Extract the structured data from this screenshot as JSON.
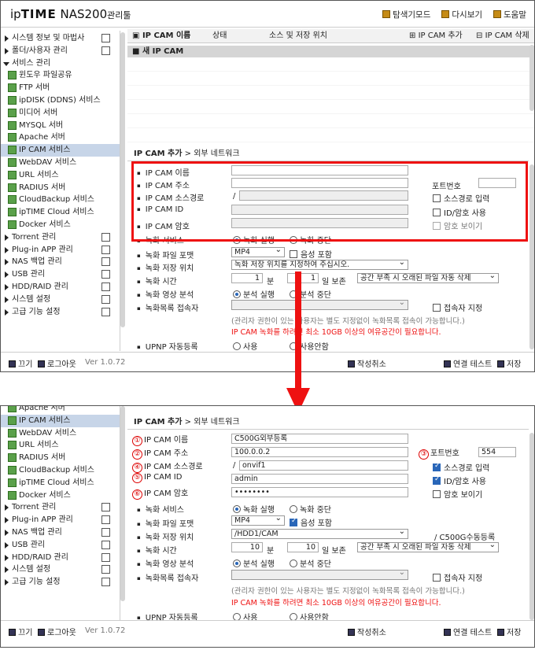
{
  "app": {
    "logo_ip": "ip",
    "logo_time": "TIME",
    "logo_model": "NAS200",
    "logo_suffix": "관리툴"
  },
  "toplinks": [
    "탐색기모드",
    "다시보기",
    "도움말"
  ],
  "sidebar": {
    "shot1": [
      {
        "label": "시스템 정보 및 마법사",
        "kind": "top"
      },
      {
        "label": "폴더/사용자 관리",
        "kind": "top"
      },
      {
        "label": "서비스 관리",
        "kind": "open"
      },
      {
        "label": "윈도우 파일공유",
        "kind": "sub"
      },
      {
        "label": "FTP 서버",
        "kind": "sub"
      },
      {
        "label": "ipDISK (DDNS) 서비스",
        "kind": "sub"
      },
      {
        "label": "미디어 서버",
        "kind": "sub"
      },
      {
        "label": "MYSQL 서버",
        "kind": "sub"
      },
      {
        "label": "Apache 서버",
        "kind": "sub"
      },
      {
        "label": "IP CAM 서비스",
        "kind": "sub",
        "selected": true
      },
      {
        "label": "WebDAV 서비스",
        "kind": "sub"
      },
      {
        "label": "URL 서비스",
        "kind": "sub"
      },
      {
        "label": "RADIUS 서버",
        "kind": "sub"
      },
      {
        "label": "CloudBackup 서비스",
        "kind": "sub"
      },
      {
        "label": "ipTIME Cloud 서비스",
        "kind": "sub"
      },
      {
        "label": "Docker 서비스",
        "kind": "sub"
      },
      {
        "label": "Torrent 관리",
        "kind": "top"
      },
      {
        "label": "Plug-in APP 관리",
        "kind": "top"
      },
      {
        "label": "NAS 백업 관리",
        "kind": "top"
      },
      {
        "label": "USB 관리",
        "kind": "top"
      },
      {
        "label": "HDD/RAID 관리",
        "kind": "top"
      },
      {
        "label": "시스템 설정",
        "kind": "top"
      },
      {
        "label": "고급 기능 설정",
        "kind": "top"
      }
    ],
    "shot2": [
      {
        "label": "Apache 서버",
        "kind": "sub"
      },
      {
        "label": "IP CAM 서비스",
        "kind": "sub",
        "selected": true
      },
      {
        "label": "WebDAV 서비스",
        "kind": "sub"
      },
      {
        "label": "URL 서비스",
        "kind": "sub"
      },
      {
        "label": "RADIUS 서버",
        "kind": "sub"
      },
      {
        "label": "CloudBackup 서비스",
        "kind": "sub"
      },
      {
        "label": "ipTIME Cloud 서비스",
        "kind": "sub"
      },
      {
        "label": "Docker 서비스",
        "kind": "sub"
      },
      {
        "label": "Torrent 관리",
        "kind": "top"
      },
      {
        "label": "Plug-in APP 관리",
        "kind": "top"
      },
      {
        "label": "NAS 백업 관리",
        "kind": "top"
      },
      {
        "label": "USB 관리",
        "kind": "top"
      },
      {
        "label": "HDD/RAID 관리",
        "kind": "top"
      },
      {
        "label": "시스템 설정",
        "kind": "top"
      },
      {
        "label": "고급 기능 설정",
        "kind": "top"
      }
    ]
  },
  "list": {
    "col_name": "IP CAM 이름",
    "col_status": "상태",
    "col_source": "소스 및 저장 위치",
    "add_btn": "IP CAM 추가",
    "del_btn": "IP CAM 삭제",
    "new_item": "새 IP CAM"
  },
  "section_title": "IP CAM 추가",
  "section_sub": " > 외부 네트워크",
  "labels": {
    "name": "IP CAM 이름",
    "addr": "IP CAM 주소",
    "src": "IP CAM 소스경로",
    "id": "IP CAM ID",
    "pw": "IP CAM 암호",
    "port": "포트번호",
    "rec_svc": "녹화 서비스",
    "rec_fmt": "녹화 파일 포맷",
    "rec_loc": "녹화 저장 위치",
    "rec_time": "녹화 시간",
    "analysis": "녹화 영상 분석",
    "access": "녹화목록 접속자",
    "upnp": "UPNP 자동등록"
  },
  "opts": {
    "src_input": "소스경로 입력",
    "id_pw_use": "ID/암호 사용",
    "show_pw": "암호 보이기",
    "rec_on": "녹화 실행",
    "rec_off": "녹화 중단",
    "audio": "음성 포함",
    "ana_on": "분석 실행",
    "ana_off": "분석 중단",
    "acc_chk": "접속자 지정",
    "upnp_use": "사용",
    "upnp_nouse": "사용안함",
    "minute": "분",
    "keep_day": "일 보존",
    "auto_del": "공간 부족 시 오래된 파일 자동 삭제",
    "slash": "/"
  },
  "notes": {
    "access": "(관리자 권한이 있는 사용자는 별도 지정없이 녹화목록 접속이 가능합니다.)",
    "space": "IP CAM 녹화를 하려면 최소 10GB 이상의 여유공간이 필요합니다."
  },
  "form1": {
    "fmt": "MP4",
    "loc": "녹화 저장 위치를 지정하여 주십시오.",
    "rec_min": "1",
    "keep": "1"
  },
  "form2": {
    "name": "C500G외부등록",
    "addr": "100.0.0.2",
    "port": "554",
    "src": "onvif1",
    "id": "admin",
    "pw": "••••••••",
    "fmt": "MP4",
    "loc": "/HDD1/CAM",
    "loc_suffix": "/ C500G수동등록",
    "rec_min": "10",
    "keep": "10"
  },
  "markers": [
    "①",
    "②",
    "③",
    "④",
    "⑤",
    "⑥"
  ],
  "footer": {
    "off": "끄기",
    "logout": "로그아웃",
    "version": "Ver 1.0.72",
    "cancel": "작성취소",
    "test": "연결 테스트",
    "save": "저장"
  },
  "colors": {
    "accent_red": "#ee1111",
    "selected_bg": "#c7d5e8",
    "check_blue": "#2966b8"
  }
}
